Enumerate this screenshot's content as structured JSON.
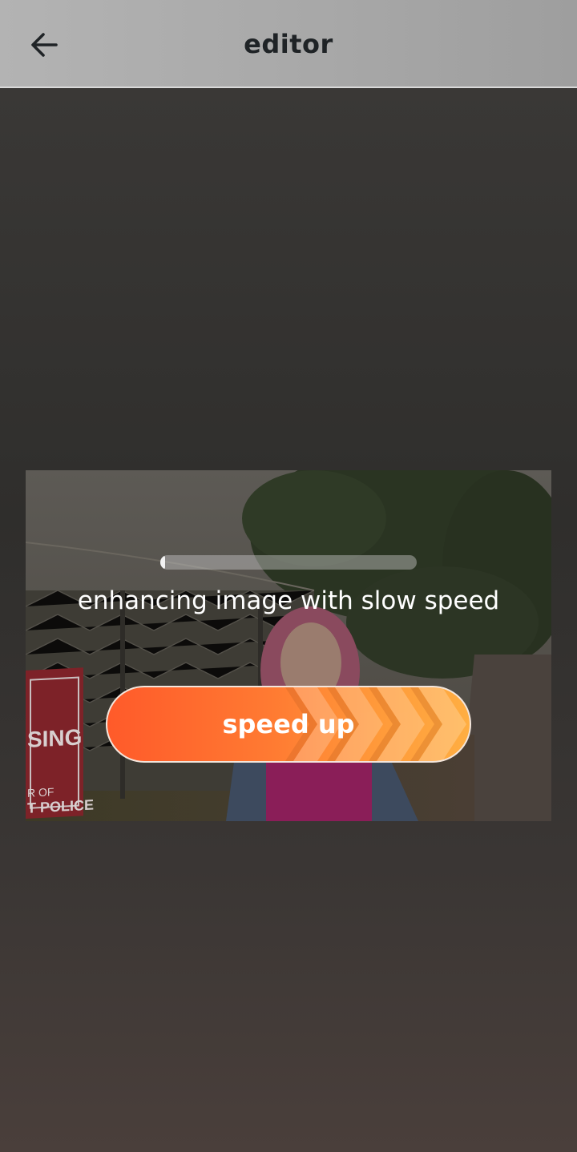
{
  "header": {
    "title": "editor",
    "back_icon": "arrow-left-icon"
  },
  "image": {
    "sign_lines": [
      "SING",
      "R OF",
      "T POLICE"
    ]
  },
  "enhance": {
    "progress_fraction": 0.01,
    "status_text": "enhancing image with slow speed",
    "speed_up_label": "speed up"
  },
  "colors": {
    "accent_start": "#ff5a2a",
    "accent_end": "#ffae42",
    "app_bar": "#ababab"
  }
}
